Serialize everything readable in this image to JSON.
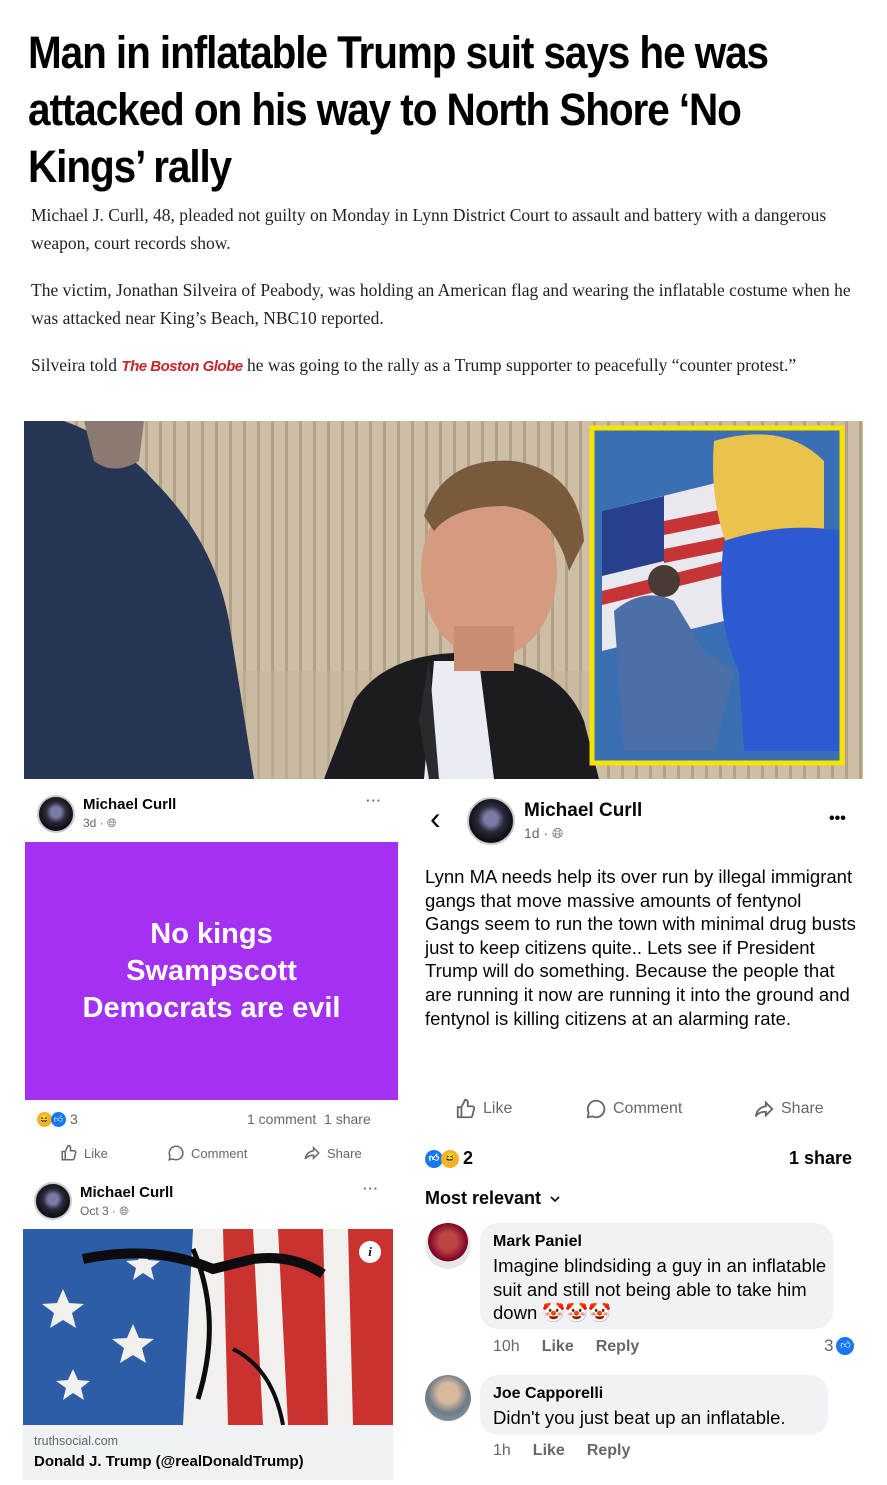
{
  "article": {
    "headline": "Man in inflatable Trump suit says he was attacked on his way to North Shore ‘No Kings’ rally",
    "p1": "Michael J. Curll, 48, pleaded not guilty on Monday in Lynn District Court to assault and battery with a dangerous weapon, court records show.",
    "p2": "The victim, Jonathan Silveira of Peabody, was holding an American flag and wearing the inflatable costume when he was attacked near King’s Beach, NBC10 reported.",
    "p3_before": "Silveira told ",
    "p3_source": "The Boston Globe",
    "p3_after": " he was going to the rally as a Trump supporter to peacefully “counter protest.”"
  },
  "post_left": {
    "author": "Michael Curll",
    "meta": "3d · ",
    "more": "···",
    "card_text": "No kings Swampscott Democrats are evil",
    "card_color": "#a431f2",
    "reaction_count": "3",
    "stats": "1 comment  1 share",
    "like": "Like",
    "comment": "Comment",
    "share": "Share"
  },
  "post_left2": {
    "author": "Michael Curll",
    "meta": "Oct 3 · ",
    "more": "···",
    "info_icon": "i",
    "link_domain": "truthsocial.com",
    "link_title": "Donald J. Trump (@realDonaldTrump)"
  },
  "post_right": {
    "back": "‹",
    "author": "Michael Curll",
    "meta": "1d · ",
    "more": "•••",
    "body": "Lynn MA needs help its over run by illegal immigrant gangs that move massive amounts of fentynol\nGangs seem to run the town with minimal drug busts just to keep citizens quite.. Lets see if President Trump will do something. Because the people that are running it now are running it into the ground and fentynol is killing citizens at an alarming rate.",
    "like": "Like",
    "comment": "Comment",
    "share": "Share",
    "reaction_count": "2",
    "shares": "1 share",
    "sort": "Most relevant",
    "comments": [
      {
        "author": "Mark Paniel",
        "text": "Imagine blindsiding a guy in an inflatable suit and still not being able to take him down 🤡🤡🤡",
        "time": "10h",
        "like": "Like",
        "reply": "Reply",
        "count": "3"
      },
      {
        "author": "Joe Capporelli",
        "text": "Didn't you just beat up an inflatable.",
        "time": "1h",
        "like": "Like",
        "reply": "Reply"
      }
    ]
  },
  "colors": {
    "fb_gray": "#65676b",
    "like_blue": "#1877f2",
    "globe_red": "#c4262e",
    "highlight_yellow": "#f5e400"
  }
}
